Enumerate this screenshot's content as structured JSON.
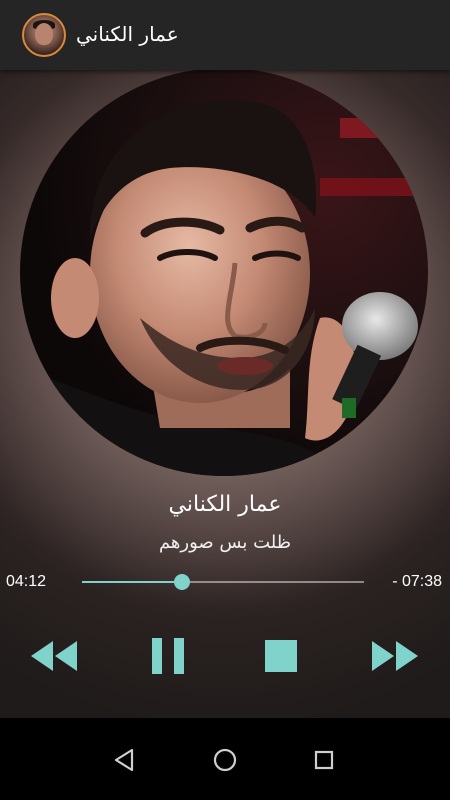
{
  "app_bar": {
    "title": "عمار الكناني",
    "avatar_icon": "artist-avatar"
  },
  "player": {
    "artist": "عمار الكناني",
    "track": "ظلت بس صورهم",
    "elapsed": "04:12",
    "remaining": "- 07:38",
    "progress_fraction": 0.355
  },
  "controls": {
    "rewind_icon": "rewind-icon",
    "pause_icon": "pause-icon",
    "stop_icon": "stop-icon",
    "fast_forward_icon": "fast-forward-icon"
  },
  "nav": {
    "back_icon": "back-icon",
    "home_icon": "home-icon",
    "recents_icon": "recents-icon"
  },
  "colors": {
    "accent": "#7fd3cb",
    "app_bar": "#252525",
    "avatar_border": "#d88a3a",
    "nav_bar": "#000000"
  }
}
